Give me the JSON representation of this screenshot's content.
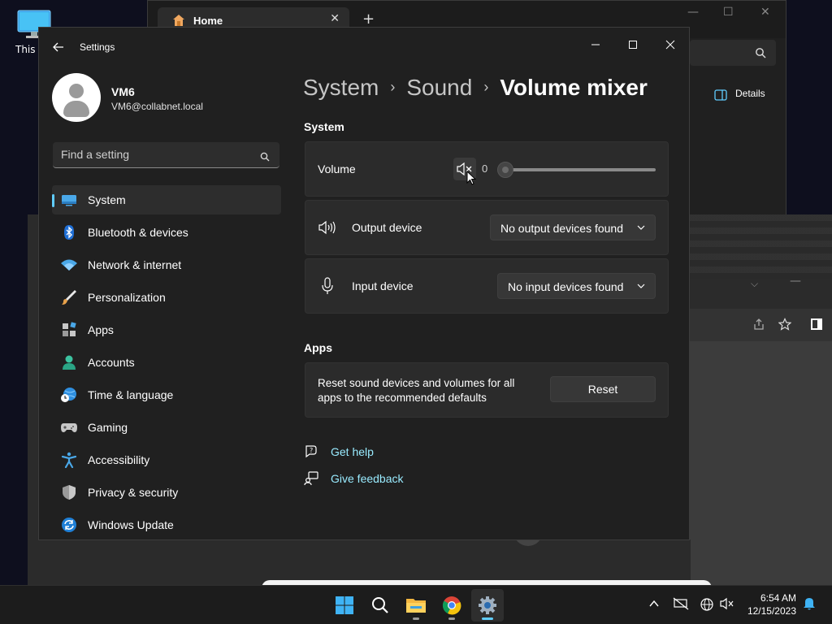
{
  "desktop": {
    "icon_label": "This P"
  },
  "explorer": {
    "tab_title": "Home",
    "details_label": "Details"
  },
  "settings": {
    "app_title": "Settings",
    "user": {
      "name": "VM6",
      "email": "VM6@collabnet.local"
    },
    "search_placeholder": "Find a setting",
    "nav": [
      {
        "label": "System",
        "icon": "system-icon",
        "active": true
      },
      {
        "label": "Bluetooth & devices",
        "icon": "bluetooth-icon"
      },
      {
        "label": "Network & internet",
        "icon": "wifi-icon"
      },
      {
        "label": "Personalization",
        "icon": "brush-icon"
      },
      {
        "label": "Apps",
        "icon": "apps-icon"
      },
      {
        "label": "Accounts",
        "icon": "accounts-icon"
      },
      {
        "label": "Time & language",
        "icon": "globe-clock-icon"
      },
      {
        "label": "Gaming",
        "icon": "gamepad-icon"
      },
      {
        "label": "Accessibility",
        "icon": "accessibility-icon"
      },
      {
        "label": "Privacy & security",
        "icon": "shield-icon"
      },
      {
        "label": "Windows Update",
        "icon": "update-icon"
      }
    ],
    "breadcrumb": [
      "System",
      "Sound",
      "Volume mixer"
    ],
    "system_section": {
      "title": "System",
      "volume": {
        "label": "Volume",
        "value": "0",
        "level": 0,
        "muted": true
      },
      "output": {
        "label": "Output device",
        "selected": "No output devices found"
      },
      "input": {
        "label": "Input device",
        "selected": "No input devices found"
      }
    },
    "apps_section": {
      "title": "Apps",
      "reset_text": "Reset sound devices and volumes for all apps to the recommended defaults",
      "reset_button": "Reset"
    },
    "links": {
      "help": "Get help",
      "feedback": "Give feedback"
    }
  },
  "taskbar": {
    "apps": [
      "start-icon",
      "search-icon",
      "file-explorer-icon",
      "chrome-icon",
      "settings-icon"
    ],
    "time": "6:54 AM",
    "date": "12/15/2023"
  },
  "colors": {
    "accent": "#60cdff",
    "link": "#99ebff",
    "window_bg": "#202020",
    "card_bg": "#2b2b2b"
  }
}
